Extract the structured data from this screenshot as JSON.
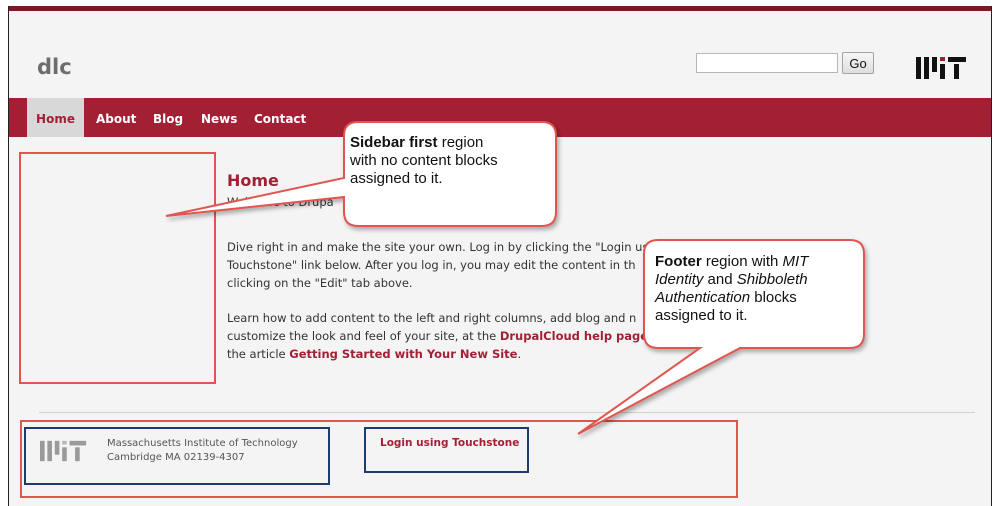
{
  "header": {
    "site_name": "dlc",
    "search_placeholder": "",
    "go_label": "Go",
    "logo_text": "MIT"
  },
  "nav": {
    "items": [
      {
        "label": "Home",
        "active": true
      },
      {
        "label": "About"
      },
      {
        "label": "Blog"
      },
      {
        "label": "News"
      },
      {
        "label": "Contact"
      }
    ]
  },
  "main": {
    "title": "Home",
    "welcome": "Welcome to Drupa",
    "para1_line1": "Dive right in and make the site your own. Log in by clicking the \"Login usi",
    "para1_line2": "Touchstone\" link below. After you log in, you may edit the content in th",
    "para1_line3": "clicking on the \"Edit\" tab above.",
    "para2_line1": "Learn how to add content to the left and right columns, add blog and n",
    "para2_line2_pre": "customize the look and feel of your site, at the ",
    "para2_line2_link": "DrupalCloud help pages",
    "para2_line3_pre": "the article ",
    "para2_line3_link": "Getting Started with Your New Site",
    "para2_line3_post": "."
  },
  "footer": {
    "org_name": "Massachusetts Institute of Technology",
    "address": "Cambridge MA 02139-4307",
    "login_link": "Login using Touchstone"
  },
  "callouts": {
    "sidebar": {
      "bold": "Sidebar first",
      "rest1": " region",
      "line2": "with no content blocks",
      "line3": "assigned to it."
    },
    "footer": {
      "bold": "Footer",
      "rest1": " region with ",
      "italic1": "MIT",
      "line2_italic": "Identity",
      "line2_mid": " and ",
      "line2_italic2": "Shibboleth",
      "line3_italic": "Authentication",
      "line3_rest": " blocks",
      "line4": "assigned to it."
    }
  },
  "colors": {
    "brand_red": "#a31f34",
    "annotation_red": "#e0554f",
    "annotation_blue": "#1d3c6e"
  }
}
